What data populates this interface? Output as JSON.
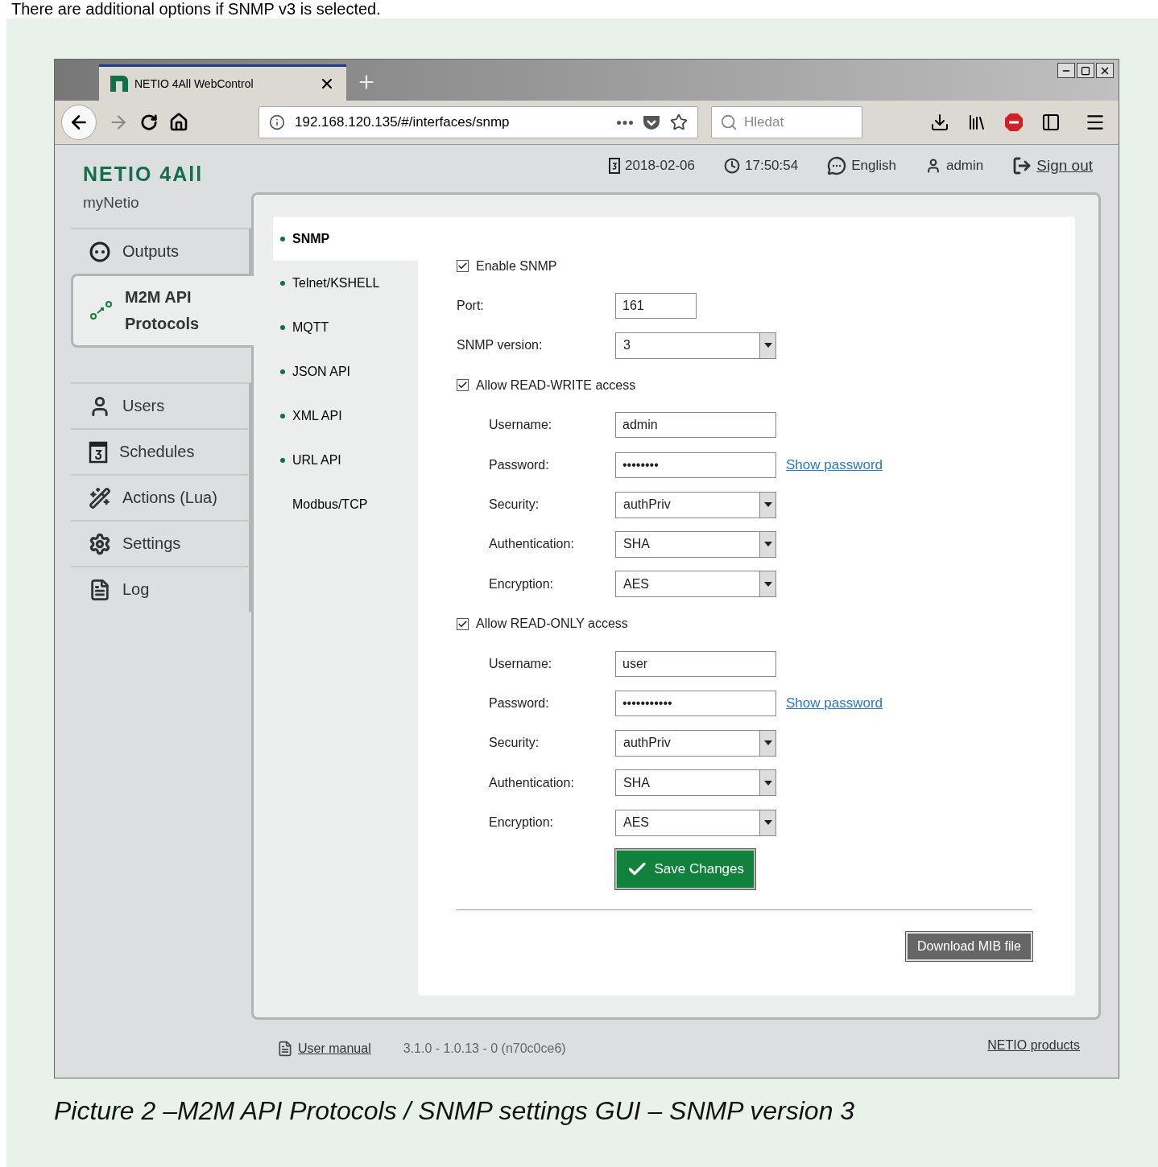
{
  "intro_text": "There are additional options if SNMP v3 is selected.",
  "browser": {
    "tab": {
      "title": "NETIO 4All WebControl"
    },
    "address": "192.168.120.135/#/interfaces/snmp",
    "search": {
      "placeholder": "Hledat"
    }
  },
  "app": {
    "logo": "NETIO 4All",
    "subtitle": "myNetio",
    "header": {
      "date": "2018-02-06",
      "time": "17:50:54",
      "language": "English",
      "user": "admin",
      "sign_out": "Sign out"
    },
    "sidebar": [
      {
        "kind": "outputs",
        "label": "Outputs",
        "selected": false
      },
      {
        "kind": "m2m",
        "label": "M2M API Protocols",
        "selected": true
      },
      {
        "kind": "users",
        "label": "Users",
        "selected": false
      },
      {
        "kind": "schedules",
        "label": "Schedules",
        "selected": false
      },
      {
        "kind": "actions",
        "label": "Actions (Lua)",
        "selected": false
      },
      {
        "kind": "settings",
        "label": "Settings",
        "selected": false
      },
      {
        "kind": "log",
        "label": "Log",
        "selected": false
      }
    ],
    "submenu": [
      {
        "label": "SNMP",
        "selected": true,
        "on": true
      },
      {
        "label": "Telnet/KSHELL",
        "selected": false,
        "on": true
      },
      {
        "label": "MQTT",
        "selected": false,
        "on": true
      },
      {
        "label": "JSON API",
        "selected": false,
        "on": true
      },
      {
        "label": "XML API",
        "selected": false,
        "on": true
      },
      {
        "label": "URL API",
        "selected": false,
        "on": true
      },
      {
        "label": "Modbus/TCP",
        "selected": false,
        "on": false
      }
    ],
    "form": {
      "enable": {
        "label": "Enable SNMP",
        "checked": true
      },
      "port": {
        "label": "Port:",
        "value": "161"
      },
      "version": {
        "label": "SNMP version:",
        "value": "3"
      },
      "access": [
        {
          "label": "Allow READ-WRITE access",
          "checked": true,
          "fields": [
            {
              "kind": "text",
              "label": "Username:",
              "value": "admin"
            },
            {
              "kind": "password",
              "label": "Password:",
              "value": "••••••••",
              "link": "Show password"
            },
            {
              "kind": "select",
              "label": "Security:",
              "value": "authPriv"
            },
            {
              "kind": "select",
              "label": "Authentication:",
              "value": "SHA"
            },
            {
              "kind": "select",
              "label": "Encryption:",
              "value": "AES"
            }
          ]
        },
        {
          "label": "Allow READ-ONLY access",
          "checked": true,
          "fields": [
            {
              "kind": "text",
              "label": "Username:",
              "value": "user"
            },
            {
              "kind": "password",
              "label": "Password:",
              "value": "•••••••••••",
              "link": "Show password"
            },
            {
              "kind": "select",
              "label": "Security:",
              "value": "authPriv"
            },
            {
              "kind": "select",
              "label": "Authentication:",
              "value": "SHA"
            },
            {
              "kind": "select",
              "label": "Encryption:",
              "value": "AES"
            }
          ]
        }
      ],
      "save": "Save Changes",
      "download": "Download MIB file"
    },
    "footer": {
      "manual": "User manual",
      "version": "3.1.0 - 1.0.13 - 0 (n70c0ce6)",
      "products": "NETIO products"
    }
  },
  "caption": "Picture 2 –M2M API Protocols / SNMP settings GUI – SNMP version 3"
}
